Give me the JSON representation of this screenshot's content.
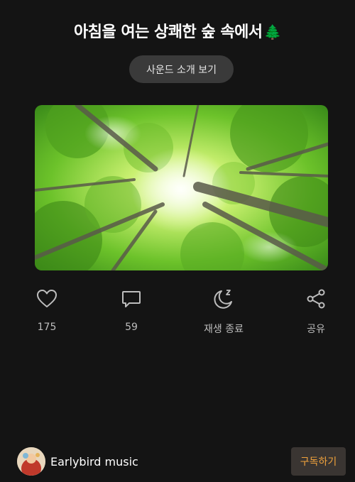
{
  "header": {
    "title": "아침을 여는 상쾌한 숲 속에서",
    "title_emoji": "🌲"
  },
  "intro_button": {
    "label": "사운드 소개 보기"
  },
  "hero_image": {
    "icon": "forest-canopy-image"
  },
  "actions": [
    {
      "icon": "heart-icon",
      "label": "175"
    },
    {
      "icon": "comment-icon",
      "label": "59"
    },
    {
      "icon": "sleep-timer-icon",
      "label": "재생 종료"
    },
    {
      "icon": "share-icon",
      "label": "공유"
    }
  ],
  "footer": {
    "channel_name": "Earlybird music",
    "subscribe_label": "구독하기"
  },
  "colors": {
    "background": "#141414",
    "button_bg": "#3a3a3a",
    "subscribe_text": "#f0a23c",
    "icon_stroke": "#bdbdbd"
  }
}
